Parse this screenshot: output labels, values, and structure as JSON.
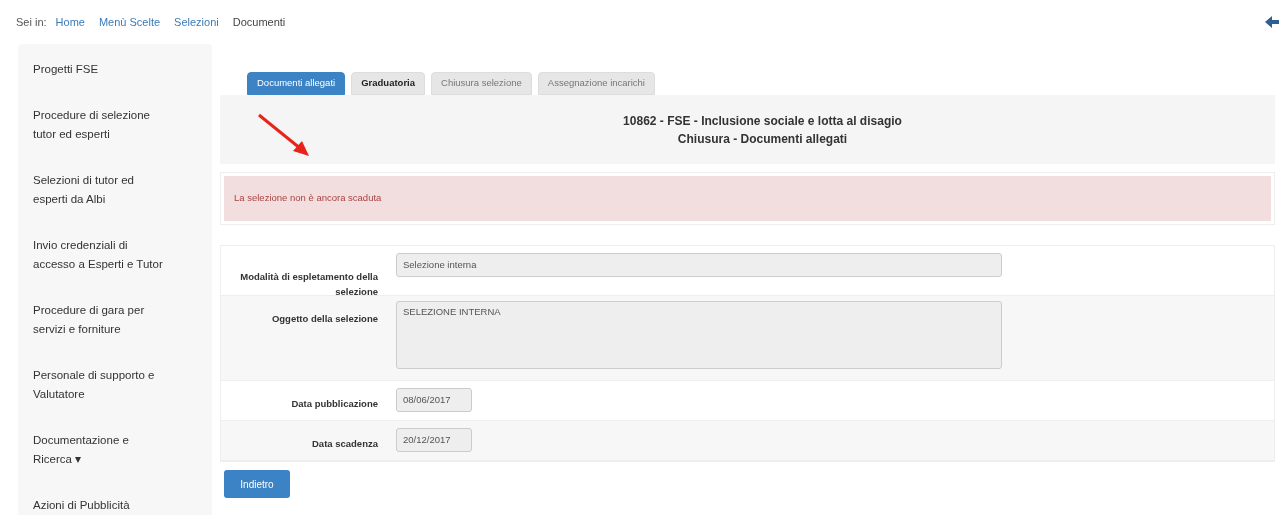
{
  "breadcrumb": {
    "label": "Sei in:",
    "items": [
      {
        "text": "Home",
        "kind": "link"
      },
      {
        "text": "Menù Scelte",
        "kind": "link"
      },
      {
        "text": "Selezioni",
        "kind": "link"
      },
      {
        "text": "Documenti",
        "kind": "current"
      }
    ]
  },
  "sidebar": {
    "items": [
      "Progetti FSE",
      "Procedure di selezione tutor ed esperti",
      "Selezioni di tutor ed esperti da Albi",
      "Invio credenziali di accesso a Esperti e Tutor",
      "Procedure di gara per servizi e forniture",
      "Personale di supporto e Valutatore",
      "Documentazione e Ricerca ▾",
      "Azioni di Pubblicità"
    ]
  },
  "tabs": [
    {
      "label": "Documenti allegati",
      "selected": true,
      "disabled": false
    },
    {
      "label": "Graduatoria",
      "selected": false,
      "disabled": false
    },
    {
      "label": "Chiusura selezione",
      "selected": false,
      "disabled": true
    },
    {
      "label": "Assegnazione incarichi",
      "selected": false,
      "disabled": true
    }
  ],
  "header": {
    "title": "10862 - FSE - Inclusione sociale e lotta al disagio",
    "subtitle": "Chiusura - Documenti allegati"
  },
  "alert": "La selezione non è ancora scaduta",
  "form": [
    {
      "label": "Modalità di espletamento della selezione",
      "value": "Selezione interna",
      "kind": "text"
    },
    {
      "label": "Oggetto della selezione",
      "value": "SELEZIONE INTERNA",
      "kind": "textarea"
    },
    {
      "label": "Data pubblicazione",
      "value": "08/06/2017",
      "kind": "date"
    },
    {
      "label": "Data scadenza",
      "value": "20/12/2017",
      "kind": "date"
    }
  ],
  "back_button": "Indietro"
}
